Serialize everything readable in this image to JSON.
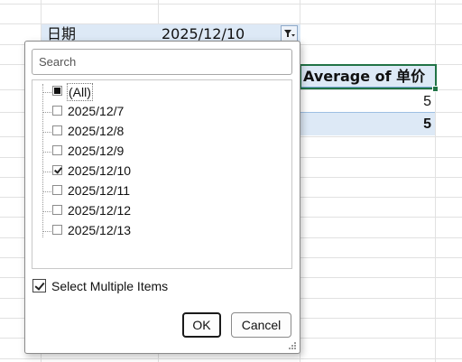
{
  "sheet": {
    "filter_field_label": "日期",
    "filter_field_value": "2025/12/10",
    "pivot_header": "Average of 单价",
    "pivot_value": "5",
    "pivot_total": "5"
  },
  "dropdown": {
    "search_placeholder": "Search",
    "items": [
      {
        "label": "(All)",
        "state": "partial"
      },
      {
        "label": "2025/12/7",
        "state": "unchecked"
      },
      {
        "label": "2025/12/8",
        "state": "unchecked"
      },
      {
        "label": "2025/12/9",
        "state": "unchecked"
      },
      {
        "label": "2025/12/10",
        "state": "checked"
      },
      {
        "label": "2025/12/11",
        "state": "unchecked"
      },
      {
        "label": "2025/12/12",
        "state": "unchecked"
      },
      {
        "label": "2025/12/13",
        "state": "unchecked"
      }
    ],
    "select_multiple_label": "Select Multiple Items",
    "select_multiple_checked": true,
    "ok_label": "OK",
    "cancel_label": "Cancel"
  },
  "colors": {
    "header_fill": "#dde9f6",
    "selection_border": "#217346"
  }
}
